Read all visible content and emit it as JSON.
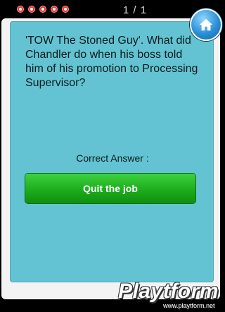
{
  "header": {
    "counter": "1 / 1",
    "dots_count": 5,
    "home_icon": "home-icon",
    "dot_color": "#e23a3a"
  },
  "question": {
    "text": "'TOW The Stoned Guy'. What did Chandler do when his boss told him of his promotion to Processing Supervisor?"
  },
  "answer": {
    "label": "Correct Answer :",
    "button_label": "Quit the job",
    "button_color": "#1fb01f"
  },
  "card": {
    "color": "#63c3d2"
  },
  "watermark": {
    "brand": "Playtform",
    "url": "www.playtform.net"
  }
}
